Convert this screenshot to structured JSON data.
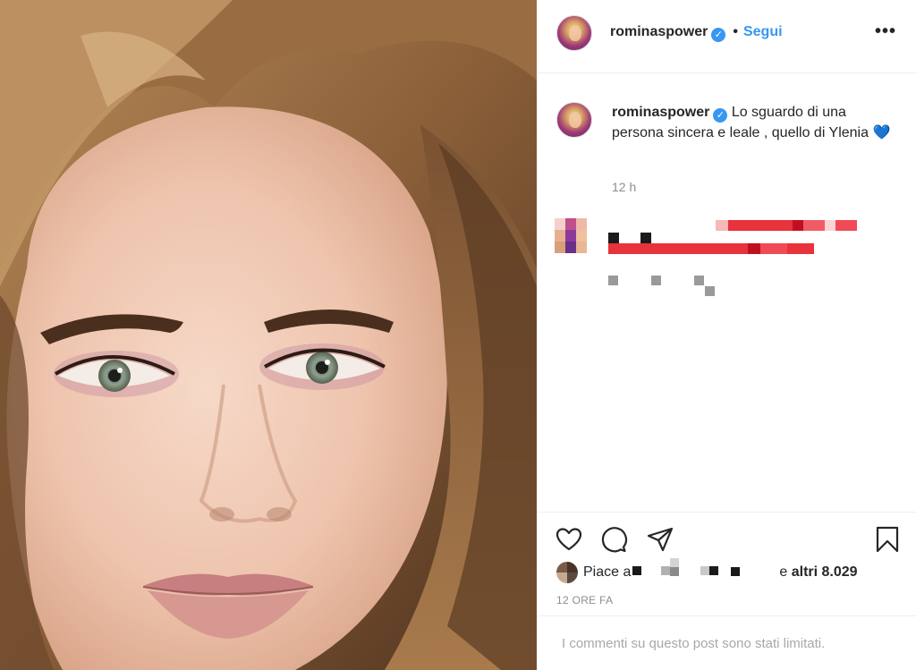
{
  "post": {
    "username": "rominaspower",
    "verified_icon": "verified-badge-icon",
    "separator": "•",
    "follow_label": "Segui",
    "more_icon": "more-options-icon",
    "more_label": "•••"
  },
  "caption": {
    "username": "rominaspower",
    "text": "Lo sguardo di una persona sincera e leale , quello di Ylenia",
    "emoji": "💙",
    "time": "12 h"
  },
  "actions": {
    "like_icon": "heart-icon",
    "comment_icon": "comment-icon",
    "share_icon": "send-icon",
    "save_icon": "bookmark-icon"
  },
  "likes": {
    "prefix": "Piace a",
    "conjunction": "e",
    "others": "altri 8.029"
  },
  "time_label": "12 ORE FA",
  "comments_limited": "I commenti su questo post sono stati limitati.",
  "colors": {
    "link_blue": "#3897f0",
    "secondary_text": "#8e8e8e",
    "censor_red": "#e8323c"
  }
}
